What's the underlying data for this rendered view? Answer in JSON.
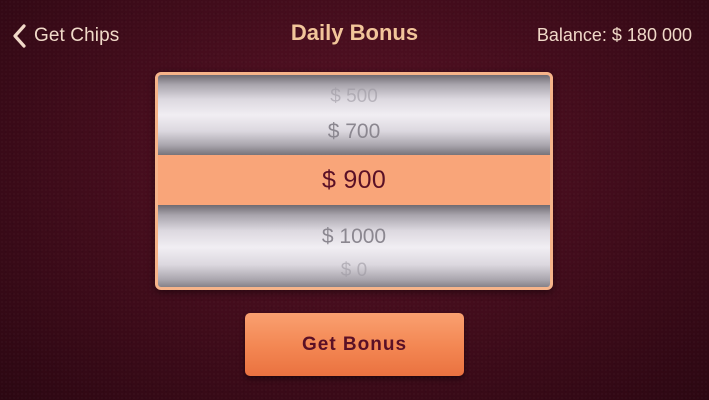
{
  "header": {
    "back_label": "Get Chips",
    "title": "Daily Bonus",
    "balance": "Balance: $ 180 000"
  },
  "picker": {
    "options": [
      "$ 500",
      "$ 700",
      "$ 900",
      "$ 1000",
      "$ 0"
    ],
    "selected": "$ 900"
  },
  "actions": {
    "get_bonus_label": "Get Bonus"
  },
  "icons": {
    "back": "chevron-left-icon"
  },
  "colors": {
    "background": "#450d1d",
    "title": "#f2c59a",
    "header_text": "#f0d9c8",
    "picker_border": "#f6b48a",
    "selection_band": "#f9a579",
    "button": "#f38652",
    "button_text": "#5a1026"
  }
}
